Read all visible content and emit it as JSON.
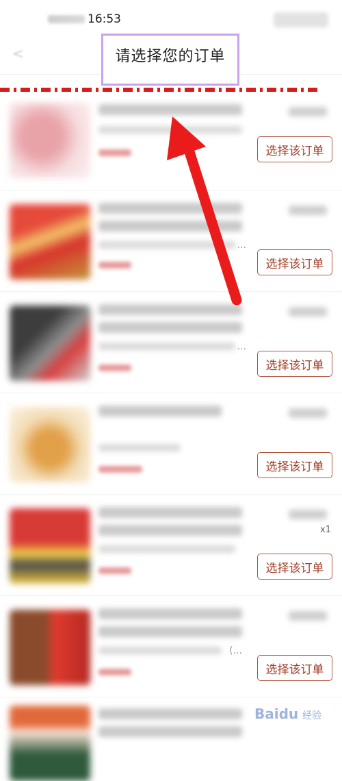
{
  "status_bar": {
    "time": "16:53"
  },
  "nav": {
    "title": "请选择您的订单"
  },
  "orders": [
    {
      "button_label": "选择该订单",
      "qty": "",
      "dots": ""
    },
    {
      "button_label": "选择该订单",
      "qty": "",
      "dots": "..."
    },
    {
      "button_label": "选择该订单",
      "qty": "",
      "dots": "..."
    },
    {
      "button_label": "选择该订单",
      "qty": "",
      "dots": ""
    },
    {
      "button_label": "选择该订单",
      "qty": "x1",
      "dots": ""
    },
    {
      "button_label": "选择该订单",
      "qty": "",
      "dots": "(..."
    }
  ],
  "colors": {
    "annotation_red": "#e01a1a",
    "title_box_border": "#c8a2ec",
    "button_text": "#a0412a"
  },
  "watermark": {
    "text": "Baidu",
    "sub": "经验"
  }
}
